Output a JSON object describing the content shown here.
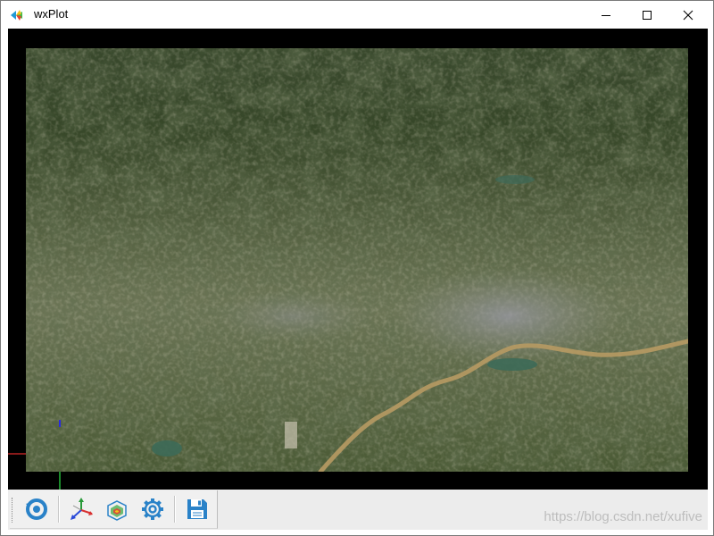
{
  "window": {
    "title": "wxPlot",
    "app_icon": "wxplot-app-icon",
    "controls": [
      {
        "name": "minimize",
        "icon": "minimize-icon"
      },
      {
        "name": "maximize",
        "icon": "maximize-icon"
      },
      {
        "name": "close",
        "icon": "close-icon"
      }
    ]
  },
  "viewport": {
    "background": "#000000",
    "content": "3D terrain map with satellite imagery",
    "axis_colors": {
      "x": "#8a1a1a",
      "y": "#1a8a2a",
      "z": "#2a2ae0"
    }
  },
  "toolbar": {
    "buttons": [
      {
        "name": "reset-view",
        "icon": "reset-view-icon"
      },
      {
        "name": "axes",
        "icon": "axes-icon"
      },
      {
        "name": "bounding-box",
        "icon": "bounding-box-icon"
      },
      {
        "name": "settings",
        "icon": "gear-icon"
      },
      {
        "name": "save",
        "icon": "save-icon"
      }
    ]
  },
  "watermark": {
    "text": "https://blog.csdn.net/xufive"
  },
  "colors": {
    "accent": "#2a82c8",
    "titlebar_bg": "#ffffff",
    "toolbar_bg": "#f0f0f0"
  }
}
